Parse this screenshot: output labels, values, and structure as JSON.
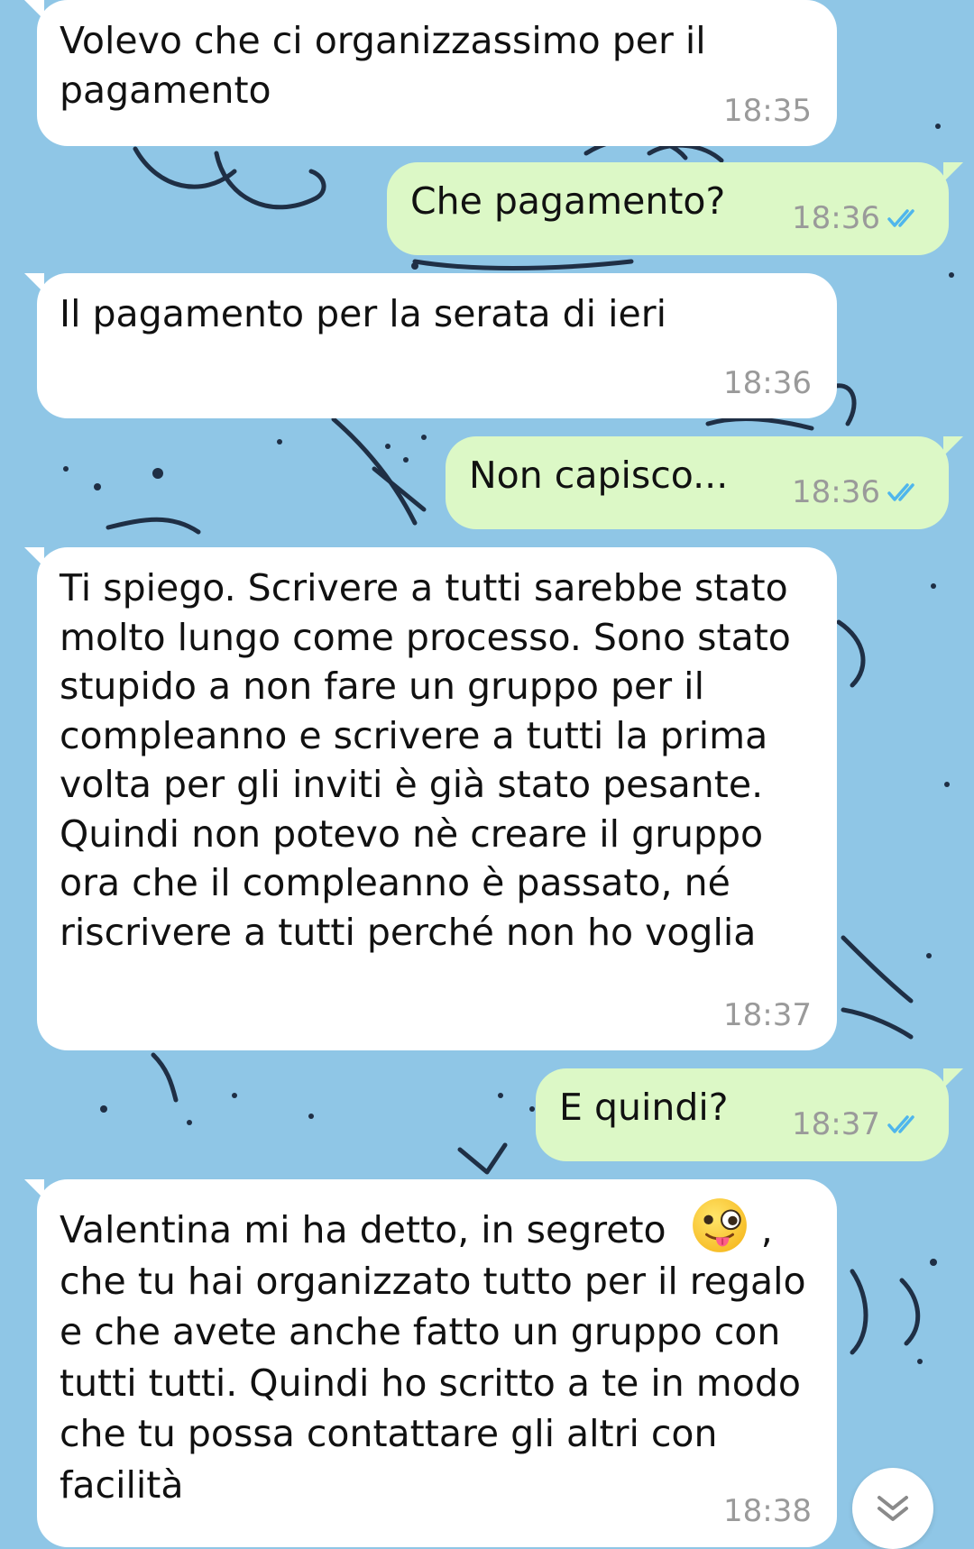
{
  "colors": {
    "wallpaper": "#8fc6e6",
    "incoming_bubble": "#ffffff",
    "outgoing_bubble": "#dcf8c6",
    "read_ticks": "#4fb6ec"
  },
  "messages": [
    {
      "direction": "incoming",
      "text": "Volevo che ci organizzassimo per il pagamento",
      "time": "18:35"
    },
    {
      "direction": "outgoing",
      "text": "Che pagamento?",
      "time": "18:36",
      "status_icon": "double-check-read-icon"
    },
    {
      "direction": "incoming",
      "text": "Il pagamento per la serata di ieri",
      "time": "18:36"
    },
    {
      "direction": "outgoing",
      "text": "Non capisco...",
      "time": "18:36",
      "status_icon": "double-check-read-icon"
    },
    {
      "direction": "incoming",
      "text": "Ti spiego. Scrivere a tutti sarebbe stato molto lungo come processo. Sono stato stupido a non fare un gruppo per il compleanno e scrivere a tutti la prima volta per gli inviti è già stato pesante. Quindi non potevo nè creare il gruppo ora che il compleanno è passato, né riscrivere a tutti perché non ho voglia",
      "time": "18:37"
    },
    {
      "direction": "outgoing",
      "text": "E quindi?",
      "time": "18:37",
      "status_icon": "double-check-read-icon"
    },
    {
      "direction": "incoming",
      "text_before_emoji": "Valentina mi ha detto, in segreto ",
      "emoji_icon": "winking-face-with-tongue-icon",
      "text_after_emoji": ", che tu hai organizzato tutto per il regalo e che avete anche fatto un gruppo con tutti tutti. Quindi ho scritto a te in modo che tu possa contattare gli altri con facilità",
      "time": "18:38"
    }
  ],
  "scroll_button_icon": "double-chevron-down-icon"
}
